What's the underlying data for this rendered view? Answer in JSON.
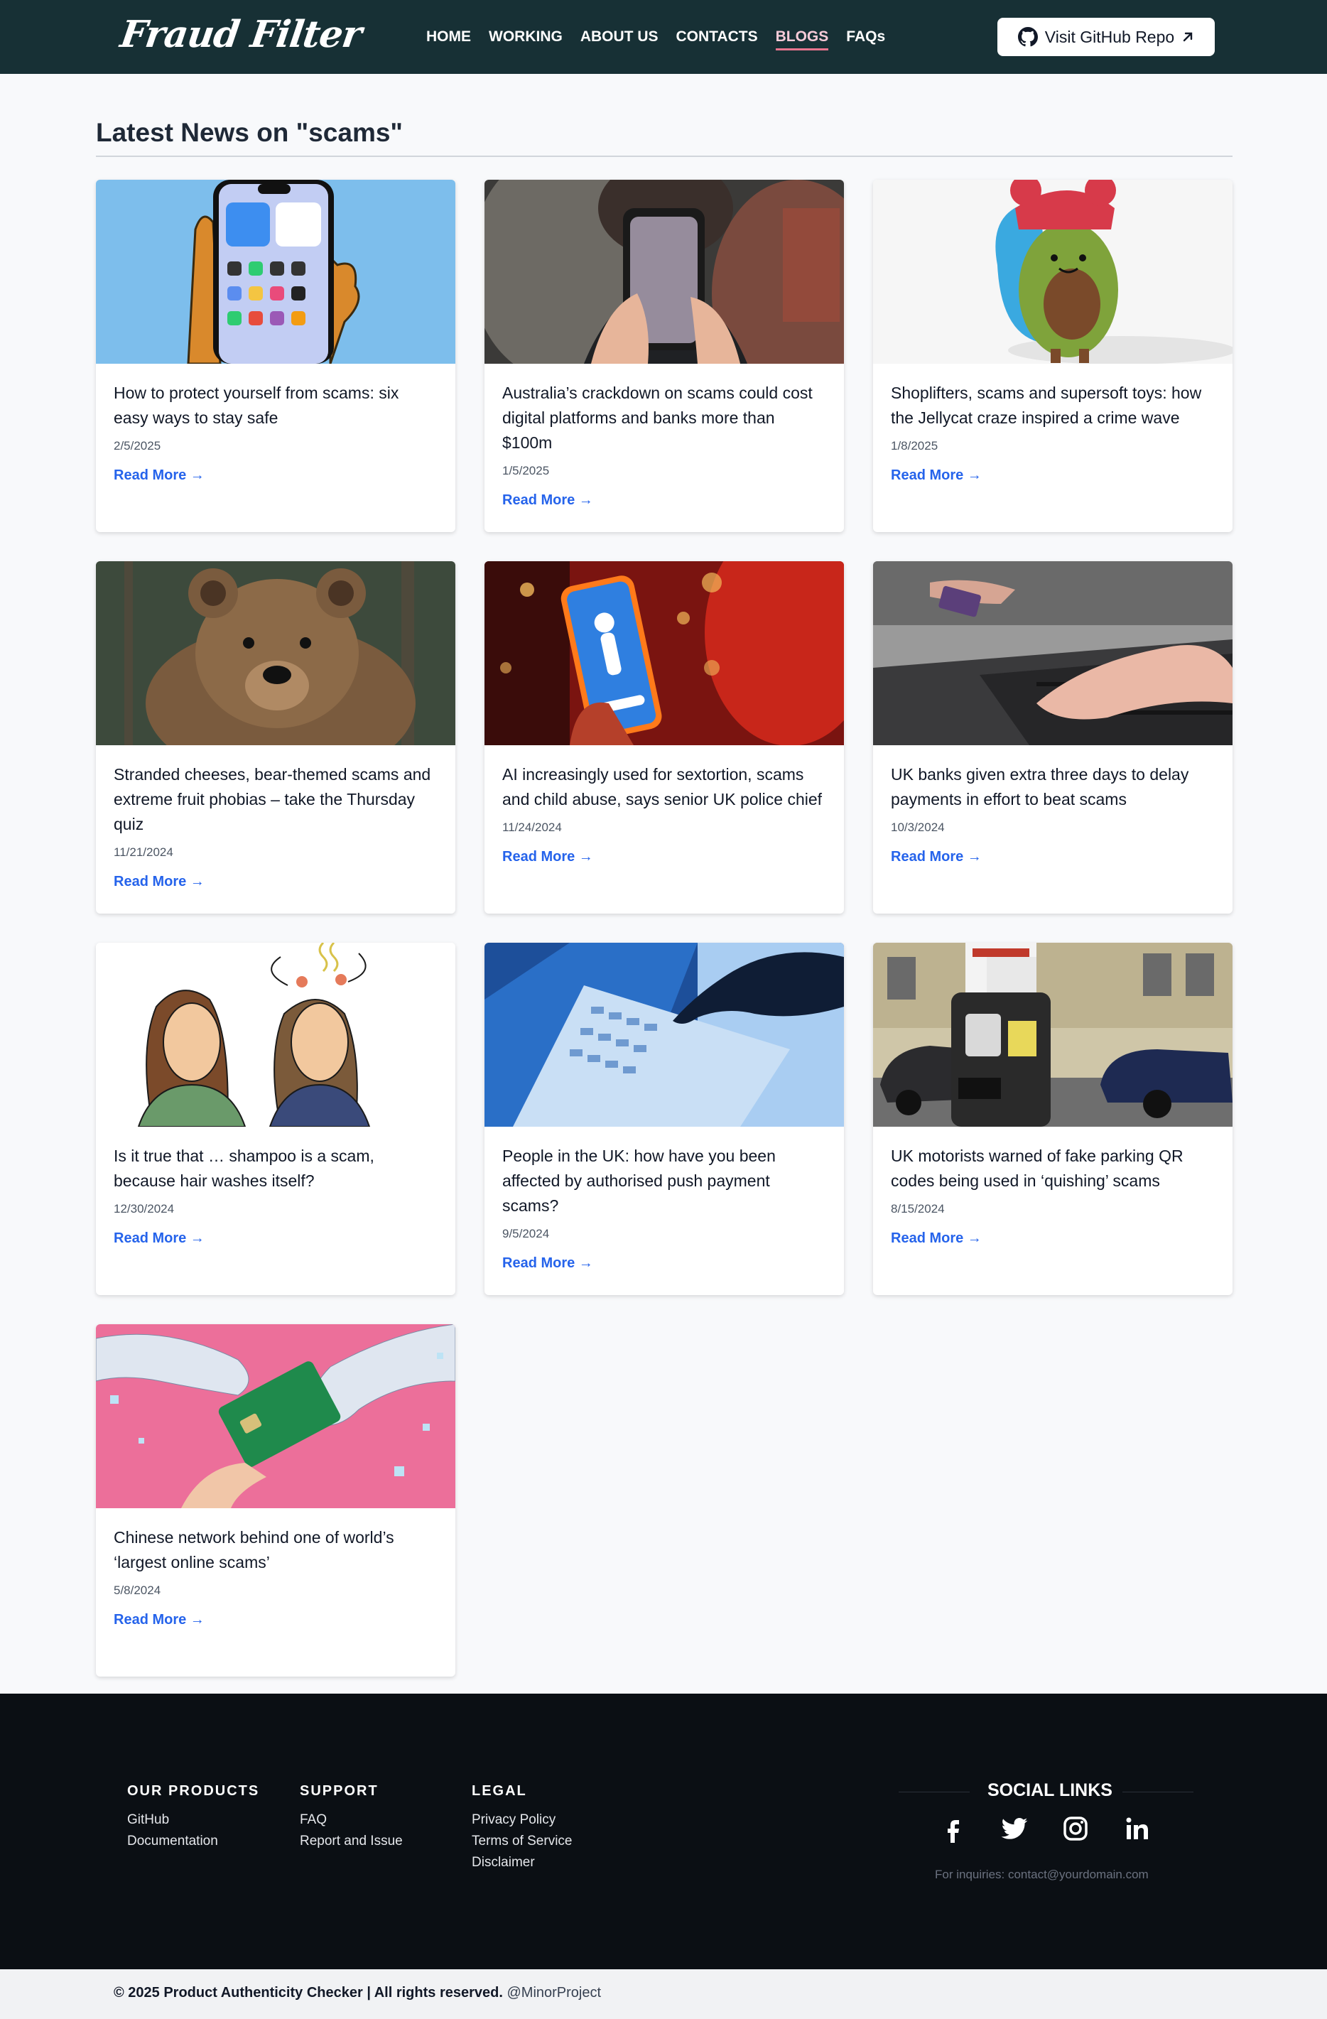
{
  "header": {
    "logo": "Fraud Filter",
    "nav": [
      {
        "label": "HOME",
        "active": false
      },
      {
        "label": "WORKING",
        "active": false
      },
      {
        "label": "ABOUT US",
        "active": false
      },
      {
        "label": "CONTACTS",
        "active": false
      },
      {
        "label": "BLOGS",
        "active": true
      },
      {
        "label": "FAQs",
        "active": false
      }
    ],
    "github_button": "Visit GitHub Repo",
    "colors": {
      "background": "#173035",
      "active_underline": "#e8758f"
    }
  },
  "main": {
    "title": "Latest News on \"scams\"",
    "read_more_label": "Read More →",
    "articles": [
      {
        "title": "How to protect yourself from scams: six easy ways to stay safe",
        "date": "2/5/2025",
        "image": "hand-holding-phone-illustration"
      },
      {
        "title": "Australia’s crackdown on scams could cost digital platforms and banks more than $100m",
        "date": "1/5/2025",
        "image": "person-holding-phone-photo"
      },
      {
        "title": "Shoplifters, scams and supersoft toys: how the Jellycat craze inspired a crime wave",
        "date": "1/8/2025",
        "image": "avocado-plush-toy-photo"
      },
      {
        "title": "Stranded cheeses, bear-themed scams and extreme fruit phobias – take the Thursday quiz",
        "date": "11/21/2024",
        "image": "bear-photo"
      },
      {
        "title": "AI increasingly used for sextortion, scams and child abuse, says senior UK police chief",
        "date": "11/24/2024",
        "image": "phone-red-background-photo"
      },
      {
        "title": "UK banks given extra three days to delay payments in effort to beat scams",
        "date": "10/3/2024",
        "image": "card-and-laptop-photo"
      },
      {
        "title": "Is it true that … shampoo is a scam, because hair washes itself?",
        "date": "12/30/2024",
        "image": "two-women-illustration"
      },
      {
        "title": "People in the UK: how have you been affected by authorised push payment scams?",
        "date": "9/5/2024",
        "image": "hand-on-laptop-blue-photo"
      },
      {
        "title": "UK motorists warned of fake parking QR codes being used in ‘quishing’ scams",
        "date": "8/15/2024",
        "image": "parking-meter-photo"
      },
      {
        "title": "Chinese network behind one of world’s ‘largest online scams’",
        "date": "5/8/2024",
        "image": "credit-card-pink-illustration"
      }
    ]
  },
  "footer": {
    "columns": [
      {
        "heading": "OUR PRODUCTS",
        "links": [
          "GitHub",
          "Documentation"
        ]
      },
      {
        "heading": "SUPPORT",
        "links": [
          "FAQ",
          "Report and Issue"
        ]
      },
      {
        "heading": "LEGAL",
        "links": [
          "Privacy Policy",
          "Terms of Service",
          "Disclaimer"
        ]
      }
    ],
    "social_title": "SOCIAL LINKS",
    "social_icons": [
      "facebook-icon",
      "twitter-icon",
      "instagram-icon",
      "linkedin-icon"
    ],
    "inquiry": "For inquiries: contact@yourdomain.com",
    "copyright": "© 2025 Product Authenticity Checker | All rights reserved.",
    "handle": "@MinorProject"
  }
}
